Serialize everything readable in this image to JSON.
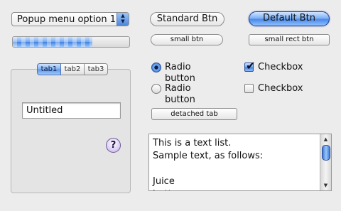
{
  "popup": {
    "label": "Popup menu option 1",
    "arrow_up": "▲",
    "arrow_down": "▼"
  },
  "progress": {
    "fraction": 0.68
  },
  "buttons": {
    "standard": "Standard Btn",
    "default": "Default Btn",
    "small": "small btn",
    "small_rect": "small rect btn",
    "detached_tab": "detached tab"
  },
  "tabs": [
    {
      "label": "tab1",
      "selected": true
    },
    {
      "label": "tab2",
      "selected": false
    },
    {
      "label": "tab3",
      "selected": false
    }
  ],
  "textfield": {
    "value": "Untitled"
  },
  "help": {
    "label": "?"
  },
  "radios": [
    {
      "label": "Radio button",
      "selected": true
    },
    {
      "label": "Radio button",
      "selected": false
    }
  ],
  "checkboxes": [
    {
      "label": "Checkbox",
      "checked": true,
      "mark": "✔"
    },
    {
      "label": "Checkbox",
      "checked": false
    }
  ],
  "text_list": {
    "text": "This is a text list.\nSample text, as follows:\n\nJuice\nbutter"
  },
  "scrollbar": {
    "up": "▲",
    "down": "▼"
  }
}
